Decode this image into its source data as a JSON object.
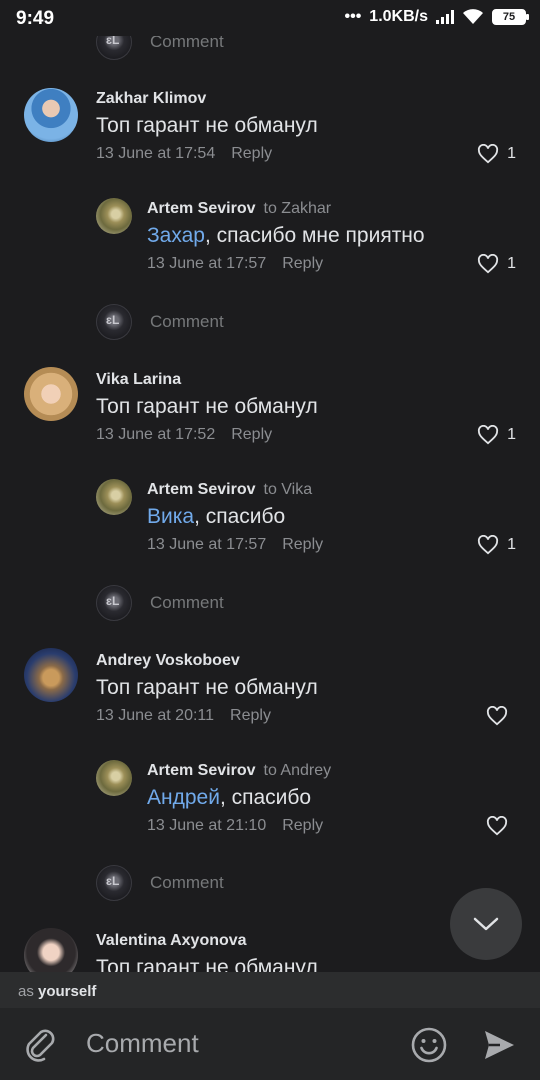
{
  "status_bar": {
    "time": "9:49",
    "net_speed": "1.0KB/s",
    "battery": "75"
  },
  "stub_label": "Comment",
  "comments": [
    {
      "author": "Zakhar Klimov",
      "text": "Топ гарант не обманул",
      "date": "13 June at 17:54",
      "reply_label": "Reply",
      "likes": "1",
      "reply": {
        "author": "Artem Sevirov",
        "to": "to Zakhar",
        "mention": "Захар",
        "text": ", спасибо мне приятно",
        "date": "13 June at 17:57",
        "reply_label": "Reply",
        "likes": "1"
      }
    },
    {
      "author": "Vika Larina",
      "text": "Топ гарант не обманул",
      "date": "13 June at 17:52",
      "reply_label": "Reply",
      "likes": "1",
      "reply": {
        "author": "Artem Sevirov",
        "to": "to Vika",
        "mention": "Вика",
        "text": ", спасибо",
        "date": "13 June at 17:57",
        "reply_label": "Reply",
        "likes": "1"
      }
    },
    {
      "author": "Andrey Voskoboev",
      "text": "Топ гарант не обманул",
      "date": "13 June at 20:11",
      "reply_label": "Reply",
      "likes": "",
      "reply": {
        "author": "Artem Sevirov",
        "to": "to Andrey",
        "mention": "Андрей",
        "text": ", спасибо",
        "date": "13 June at 21:10",
        "reply_label": "Reply",
        "likes": ""
      }
    },
    {
      "author": "Valentina Axyonova",
      "text": "Топ гарант не обманул"
    }
  ],
  "composer": {
    "as_prefix": "as",
    "as_identity": "yourself",
    "placeholder": "Comment"
  },
  "icons": {
    "scroll": "chevron-down-icon",
    "attach": "paperclip-icon",
    "emoji": "smiley-icon",
    "send": "send-icon",
    "like": "heart-icon"
  },
  "colors": {
    "background": "#1c1c1e",
    "mention": "#71aaeb",
    "muted": "#8b8d91"
  }
}
